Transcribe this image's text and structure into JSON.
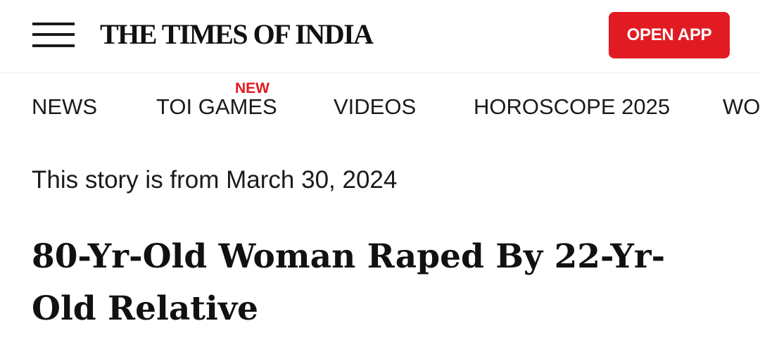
{
  "header": {
    "menu_icon": "hamburger-menu-icon",
    "logo_text": "THE TIMES OF INDIA",
    "open_app_label": "OPEN APP",
    "open_app_color": "#e21b22"
  },
  "nav": {
    "items": [
      {
        "label": "NEWS"
      },
      {
        "label": "TOI GAMES",
        "badge": "NEW"
      },
      {
        "label": "VIDEOS"
      },
      {
        "label": "HOROSCOPE 2025"
      },
      {
        "label": "WO"
      }
    ],
    "badge_color": "#e21b22"
  },
  "article": {
    "date_note": "This story is from March 30, 2024",
    "headline": "80-Yr-Old Woman Raped By 22-Yr-Old Relative"
  }
}
